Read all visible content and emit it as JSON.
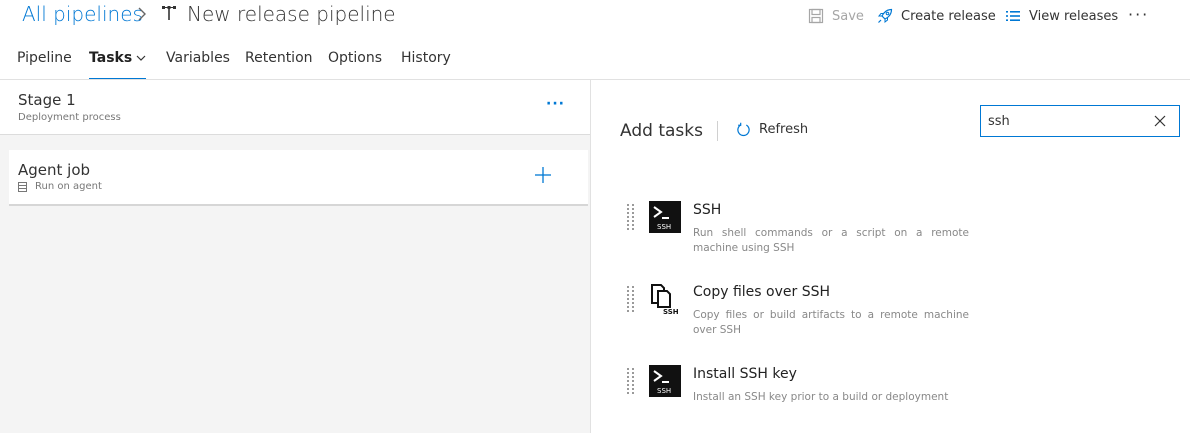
{
  "header": {
    "breadcrumb_root": "All pipelines",
    "title": "New release pipeline",
    "commands": {
      "save": "Save",
      "create_release": "Create release",
      "view_releases": "View releases",
      "more": "···"
    }
  },
  "tabs": [
    {
      "label": "Pipeline",
      "active": false
    },
    {
      "label": "Tasks",
      "active": true
    },
    {
      "label": "Variables",
      "active": false
    },
    {
      "label": "Retention",
      "active": false
    },
    {
      "label": "Options",
      "active": false
    },
    {
      "label": "History",
      "active": false
    }
  ],
  "stage": {
    "name": "Stage 1",
    "subtitle": "Deployment process",
    "more": "···"
  },
  "job": {
    "name": "Agent job",
    "subtitle": "Run on agent"
  },
  "add_tasks": {
    "title": "Add tasks",
    "refresh_label": "Refresh",
    "search_value": "ssh",
    "results": [
      {
        "name": "SSH",
        "description": "Run shell commands or a script on a remote machine using SSH",
        "icon": "terminal-ssh-icon"
      },
      {
        "name": "Copy files over SSH",
        "description": "Copy files or build artifacts to a remote machine over SSH",
        "icon": "copy-files-ssh-icon"
      },
      {
        "name": "Install SSH key",
        "description": "Install an SSH key prior to a build or deployment",
        "icon": "terminal-ssh-icon"
      }
    ]
  },
  "colors": {
    "accent": "#0078d4",
    "left_pane_bg": "#f4f4f4",
    "disabled_text": "#a6a6a6"
  }
}
